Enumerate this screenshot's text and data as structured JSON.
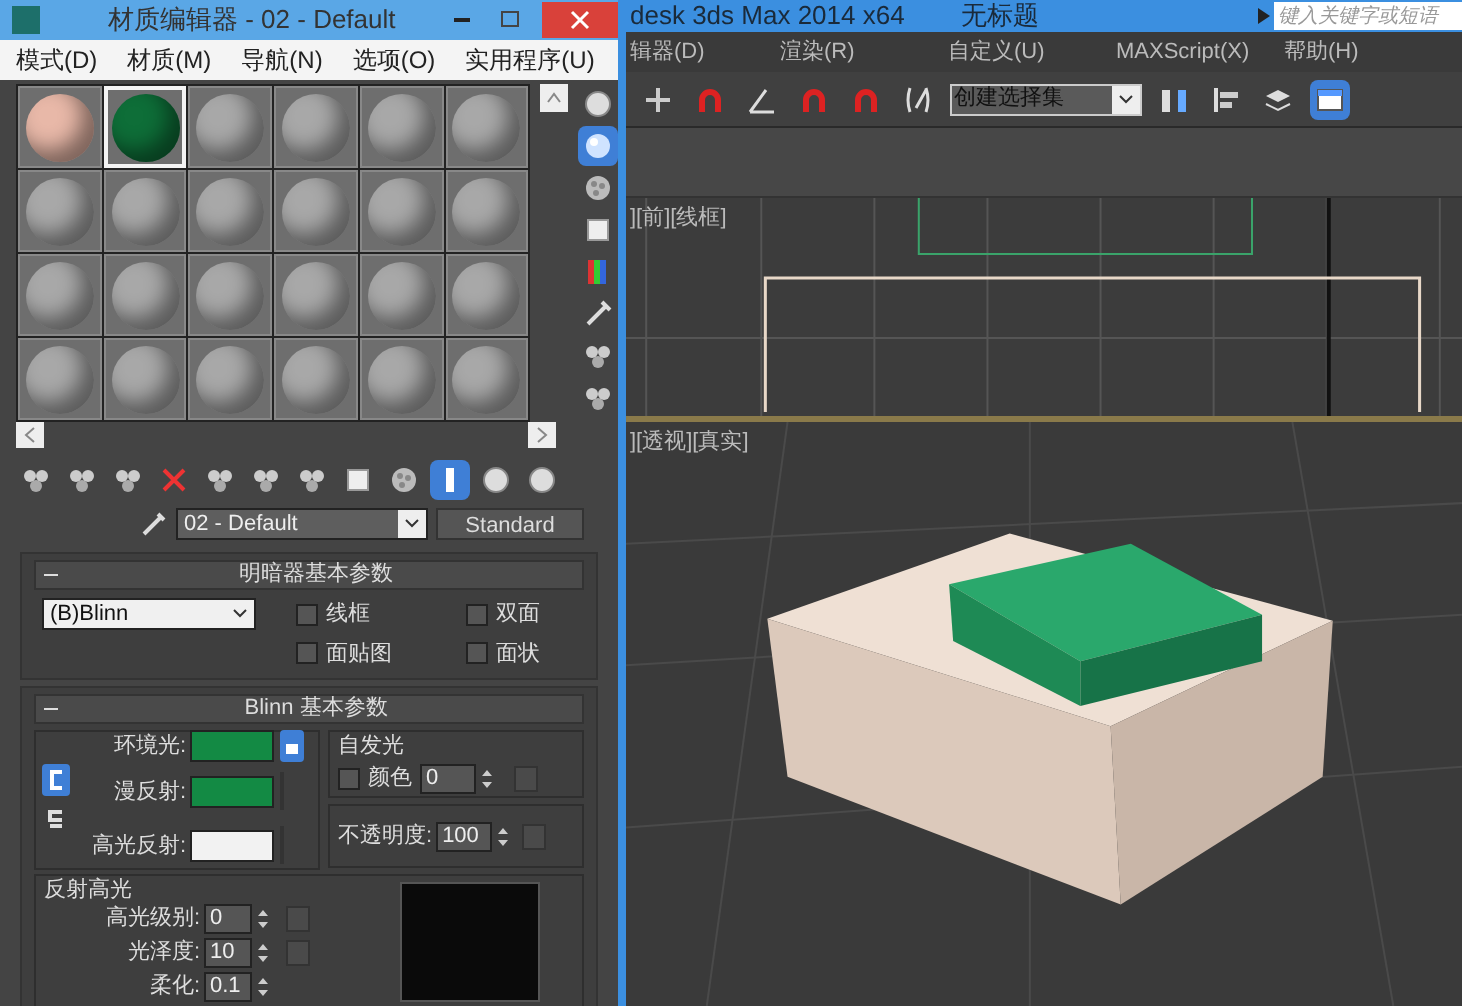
{
  "material_editor": {
    "title": "材质编辑器 - 02 - Default",
    "menu": [
      "模式(D)",
      "材质(M)",
      "导航(N)",
      "选项(O)",
      "实用程序(U)"
    ],
    "slots": [
      {
        "color": "#e8b8a8",
        "selected": false
      },
      {
        "color": "#0e6e38",
        "selected": true
      },
      {
        "color": "#a8a8a8",
        "selected": false
      },
      {
        "color": "#a8a8a8",
        "selected": false
      },
      {
        "color": "#a8a8a8",
        "selected": false
      },
      {
        "color": "#a8a8a8",
        "selected": false
      },
      {
        "color": "#a8a8a8",
        "selected": false
      },
      {
        "color": "#a8a8a8",
        "selected": false
      },
      {
        "color": "#a8a8a8",
        "selected": false
      },
      {
        "color": "#a8a8a8",
        "selected": false
      },
      {
        "color": "#a8a8a8",
        "selected": false
      },
      {
        "color": "#a8a8a8",
        "selected": false
      },
      {
        "color": "#a8a8a8",
        "selected": false
      },
      {
        "color": "#a8a8a8",
        "selected": false
      },
      {
        "color": "#a8a8a8",
        "selected": false
      },
      {
        "color": "#a8a8a8",
        "selected": false
      },
      {
        "color": "#a8a8a8",
        "selected": false
      },
      {
        "color": "#a8a8a8",
        "selected": false
      },
      {
        "color": "#a8a8a8",
        "selected": false
      },
      {
        "color": "#a8a8a8",
        "selected": false
      },
      {
        "color": "#a8a8a8",
        "selected": false
      },
      {
        "color": "#a8a8a8",
        "selected": false
      },
      {
        "color": "#a8a8a8",
        "selected": false
      },
      {
        "color": "#a8a8a8",
        "selected": false
      }
    ],
    "side_tools": [
      {
        "kind": "sphere",
        "on": false
      },
      {
        "kind": "light",
        "on": true
      },
      {
        "kind": "checker",
        "on": false
      },
      {
        "kind": "square",
        "on": false
      },
      {
        "kind": "palette",
        "on": false
      },
      {
        "kind": "wand",
        "on": false
      },
      {
        "kind": "spheres",
        "on": false
      },
      {
        "kind": "spheres",
        "on": false
      }
    ],
    "toolbar": [
      {
        "kind": "spheres",
        "on": false
      },
      {
        "kind": "spheres",
        "on": false
      },
      {
        "kind": "spheres",
        "on": false
      },
      {
        "kind": "delete",
        "on": false
      },
      {
        "kind": "spheres",
        "on": false
      },
      {
        "kind": "spheres",
        "on": false
      },
      {
        "kind": "spheres",
        "on": false
      },
      {
        "kind": "square",
        "on": false
      },
      {
        "kind": "checker",
        "on": false
      },
      {
        "kind": "bar",
        "on": true
      },
      {
        "kind": "sphere",
        "on": false
      },
      {
        "kind": "sphere",
        "on": false
      }
    ],
    "material_name": "02 - Default",
    "material_type": "Standard",
    "shader_rollout": {
      "title": "明暗器基本参数",
      "expanded": true,
      "shader": "(B)Blinn",
      "options": [
        {
          "label": "线框",
          "checked": false
        },
        {
          "label": "双面",
          "checked": false
        },
        {
          "label": "面贴图",
          "checked": false
        },
        {
          "label": "面状",
          "checked": false
        }
      ]
    },
    "blinn_rollout": {
      "title": "Blinn 基本参数",
      "expanded": true,
      "colors": [
        {
          "label": "环境光:",
          "color": "#138a44"
        },
        {
          "label": "漫反射:",
          "color": "#138a44"
        },
        {
          "label": "高光反射:",
          "color": "#f2f2f2"
        }
      ],
      "self_illum": {
        "title": "自发光",
        "label": "颜色",
        "checked": false,
        "value": "0"
      },
      "opacity": {
        "label": "不透明度:",
        "value": "100"
      },
      "highlights": {
        "title": "反射高光",
        "fields": [
          {
            "label": "高光级别:",
            "value": "0"
          },
          {
            "label": "光泽度:",
            "value": "10"
          },
          {
            "label": "柔化:",
            "value": "0.1"
          }
        ]
      }
    }
  },
  "main_window": {
    "title": "desk 3ds Max  2014 x64",
    "document": "无标题",
    "search": {
      "placeholder": "键入关键字或短语"
    },
    "menu": [
      "辑器(D)",
      "渲染(R)",
      "自定义(U)",
      "MAXScript(X)",
      "帮助(H)"
    ],
    "toolbar": [
      {
        "kind": "move",
        "on": false
      },
      {
        "kind": "magnet",
        "on": false
      },
      {
        "kind": "angle",
        "on": false
      },
      {
        "kind": "magnet",
        "on": false
      },
      {
        "kind": "magnet",
        "on": false
      },
      {
        "kind": "abc",
        "on": false
      }
    ],
    "selection_set": "创建选择集",
    "toolbar_right": [
      {
        "kind": "mirror",
        "on": false
      },
      {
        "kind": "align",
        "on": false
      },
      {
        "kind": "layers",
        "on": false
      },
      {
        "kind": "window",
        "on": true
      }
    ],
    "viewports": [
      {
        "kind": "front",
        "label": "][前][线框]"
      },
      {
        "kind": "perspective",
        "label": "][透视][真实]"
      }
    ]
  }
}
